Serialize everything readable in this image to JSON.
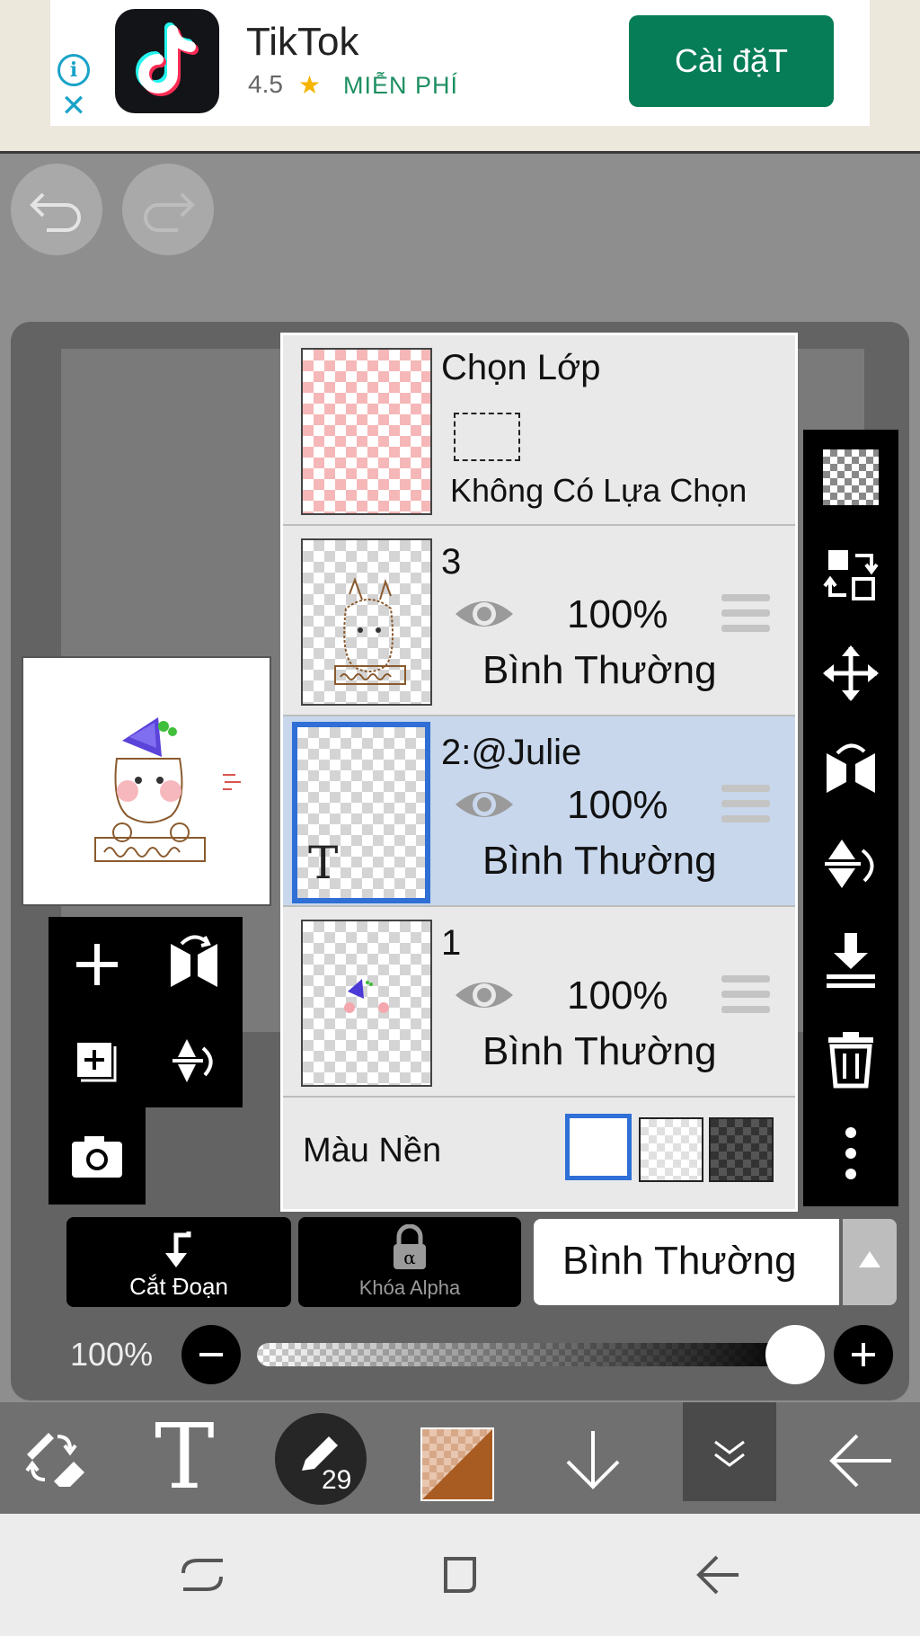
{
  "ad": {
    "app_name": "TikTok",
    "rating": "4.5",
    "price": "MIỄN PHÍ",
    "install_label": "Cài đặT",
    "info_icon": "info-icon",
    "close_icon": "close-icon"
  },
  "history": {
    "undo_icon": "undo-icon",
    "redo_icon": "redo-icon"
  },
  "layers_panel": {
    "selection_layer": {
      "title": "Chọn Lớp",
      "status": "Không Có Lựa Chọn"
    },
    "layers": [
      {
        "name": "3",
        "opacity": "100%",
        "blend": "Bình Thường",
        "selected": false
      },
      {
        "name": "2:@Julie",
        "opacity": "100%",
        "blend": "Bình Thường",
        "selected": true
      },
      {
        "name": "1",
        "opacity": "100%",
        "blend": "Bình Thường",
        "selected": false
      }
    ],
    "background_label": "Màu Nền"
  },
  "blend_controls": {
    "clip_label": "Cắt Đoạn",
    "alpha_lock_label": "Khóa Alpha",
    "blend_mode": "Bình Thường"
  },
  "opacity": {
    "value_label": "100%",
    "level": 1.0
  },
  "toolbar": {
    "brush_size": "29"
  },
  "colors": {
    "accent_blue": "#2f6fd6",
    "install_green": "#067c57",
    "selected_layer_bg": "#c8d7ec",
    "current_color": "#a85c22"
  }
}
